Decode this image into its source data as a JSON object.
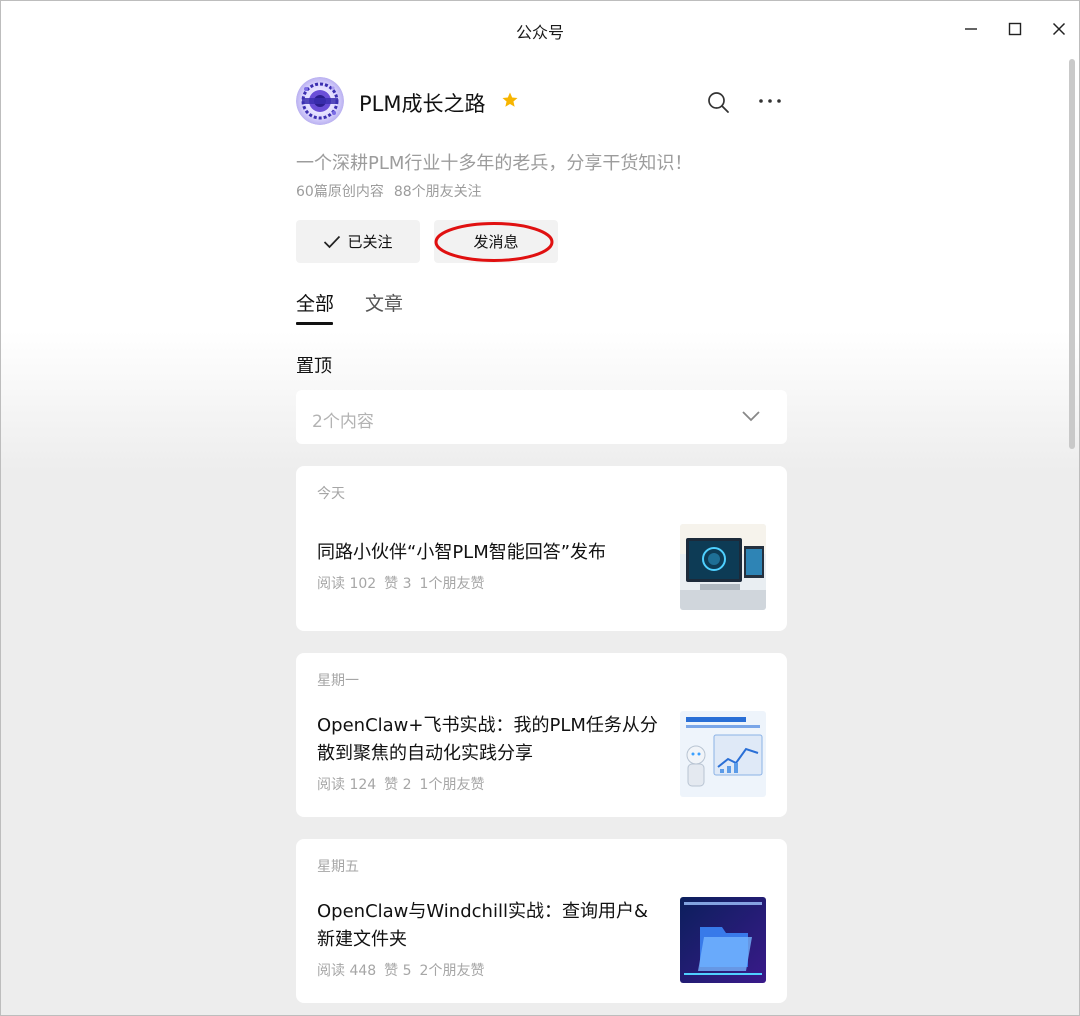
{
  "window": {
    "title": "公众号",
    "controls": [
      "minimize-icon",
      "maximize-icon",
      "close-icon"
    ]
  },
  "account": {
    "name": "PLM成长之路",
    "starred": true,
    "description": "一个深耕PLM行业十多年的老兵，分享干货知识！",
    "original_count": "60篇原创内容",
    "friends_following": "88个朋友关注",
    "follow_button": "已关注",
    "message_button": "发消息"
  },
  "tabs": [
    {
      "label": "全部",
      "active": true
    },
    {
      "label": "文章",
      "active": false
    }
  ],
  "pinned": {
    "title": "置顶",
    "count_label": "2个内容"
  },
  "articles": [
    {
      "date": "今天",
      "title": "同路小伙伴“小智PLM智能回答”发布",
      "reads": "阅读 102",
      "likes": "赞 3",
      "friend_likes": "1个朋友赞"
    },
    {
      "date": "星期一",
      "title": "OpenClaw+飞书实战：我的PLM任务从分散到聚焦的自动化实践分享",
      "reads": "阅读 124",
      "likes": "赞 2",
      "friend_likes": "1个朋友赞"
    },
    {
      "date": "星期五",
      "title": "OpenClaw与Windchill实战：查询用户&新建文件夹",
      "reads": "阅读 448",
      "likes": "赞 5",
      "friend_likes": "2个朋友赞"
    }
  ],
  "colors": {
    "star": "#f7b500",
    "highlight_ring": "#e01010",
    "background_gray": "#ededed"
  }
}
